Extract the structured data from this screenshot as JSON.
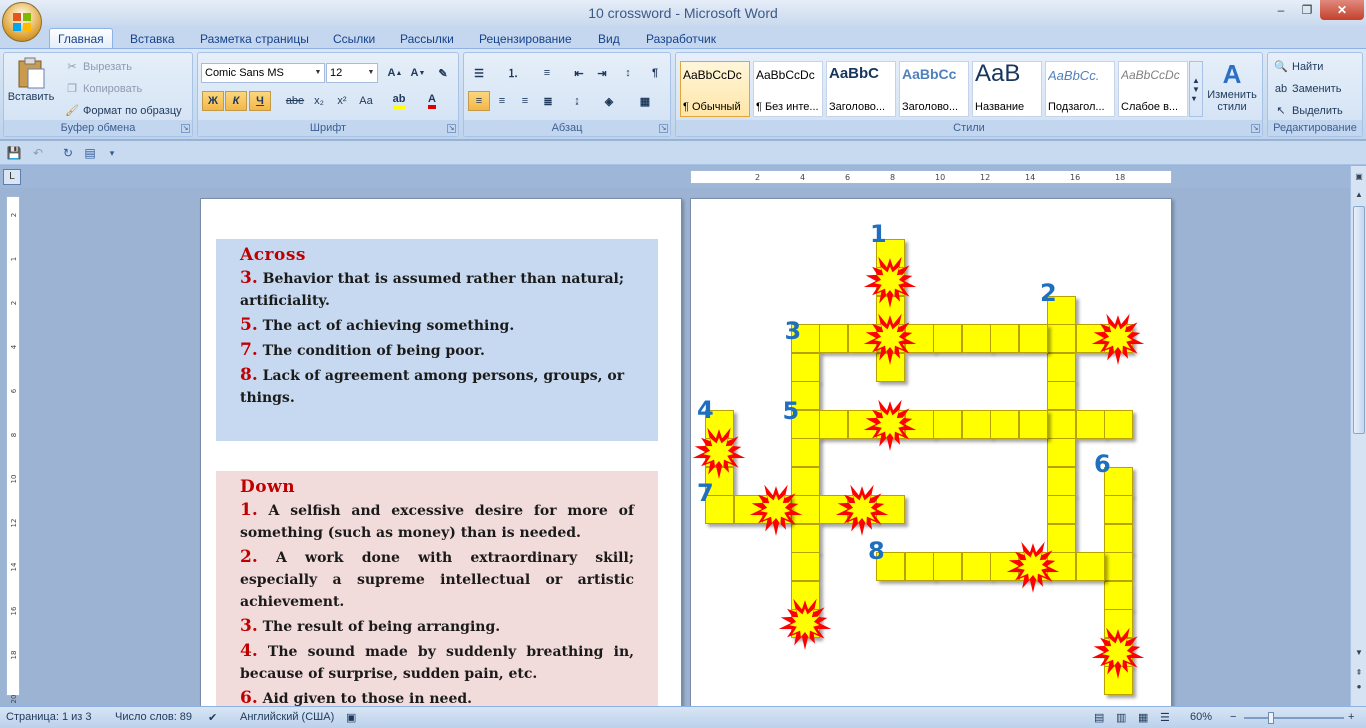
{
  "window": {
    "title": "10 crossword - Microsoft Word",
    "minimize": "–",
    "maximize": "❐",
    "close": "✕"
  },
  "tabs": [
    "Главная",
    "Вставка",
    "Разметка страницы",
    "Ссылки",
    "Рассылки",
    "Рецензирование",
    "Вид",
    "Разработчик"
  ],
  "ribbon": {
    "clipboard": {
      "label": "Буфер обмена",
      "paste": "Вставить",
      "cut": "Вырезать",
      "copy": "Копировать",
      "format_painter": "Формат по образцу"
    },
    "font": {
      "label": "Шрифт",
      "name": "Comic Sans MS",
      "size": "12",
      "bold": "Ж",
      "italic": "К",
      "underline": "Ч",
      "strike": "abe",
      "subscript": "x₂",
      "superscript": "x²",
      "change_case": "Aa"
    },
    "paragraph": {
      "label": "Абзац"
    },
    "styles": {
      "label": "Стили",
      "items": [
        {
          "sample": "AaBbCcDc",
          "name": "¶ Обычный"
        },
        {
          "sample": "AaBbCcDc",
          "name": "¶ Без инте..."
        },
        {
          "sample": "AaBbC",
          "name": "Заголово..."
        },
        {
          "sample": "AaBbCc",
          "name": "Заголово..."
        },
        {
          "sample": "AaB",
          "name": "Название"
        },
        {
          "sample": "AaBbCc.",
          "name": "Подзагол..."
        },
        {
          "sample": "AaBbCcDc",
          "name": "Слабое в..."
        }
      ],
      "change_styles": "Изменить стили"
    },
    "editing": {
      "label": "Редактирование",
      "find": "Найти",
      "replace": "Заменить",
      "select": "Выделить"
    }
  },
  "ruler": {
    "marks": [
      "2",
      "4",
      "6",
      "8",
      "10",
      "12",
      "14",
      "16",
      "18"
    ],
    "vmarks": [
      "2",
      "1",
      "2",
      "4",
      "6",
      "8",
      "10",
      "12",
      "14",
      "16",
      "18",
      "20"
    ]
  },
  "document": {
    "across": {
      "title": "Across",
      "clues": [
        {
          "num": "3.",
          "text": " Behavior that is assumed rather than natural; artificiality."
        },
        {
          "num": "5.",
          "text": " The act of achieving something."
        },
        {
          "num": "7.",
          "text": " The condition of being poor."
        },
        {
          "num": "8.",
          "text": " Lack of agreement among persons, groups, or things."
        }
      ]
    },
    "down": {
      "title": "Down",
      "clues": [
        {
          "num": "1.",
          "text": " A selfish and excessive desire for more of something (such as money) than is needed."
        },
        {
          "num": "2.",
          "text": " A work done with extraordinary skill; especially a supreme intellectual or artistic achievement."
        },
        {
          "num": "3.",
          "text": " The result of being arranging."
        },
        {
          "num": "4.",
          "text": " The sound made by suddenly breathing in, because of surprise, sudden pain, etc."
        },
        {
          "num": "6.",
          "text": " Aid given to those in need."
        }
      ]
    },
    "crossword": {
      "numbers": [
        "1",
        "2",
        "3",
        "4",
        "5",
        "6",
        "7",
        "8"
      ]
    }
  },
  "statusbar": {
    "page": "Страница: 1 из 3",
    "words": "Число слов: 89",
    "language": "Английский (США)",
    "zoom": "60%",
    "zoom_minus": "−",
    "zoom_plus": "+"
  },
  "colors": {
    "cell": "#ffff00",
    "clue_number": "#c00000",
    "grid_number": "#1f6fc0",
    "across_bg": "#c6d9f0",
    "down_bg": "#f2dcdb"
  }
}
